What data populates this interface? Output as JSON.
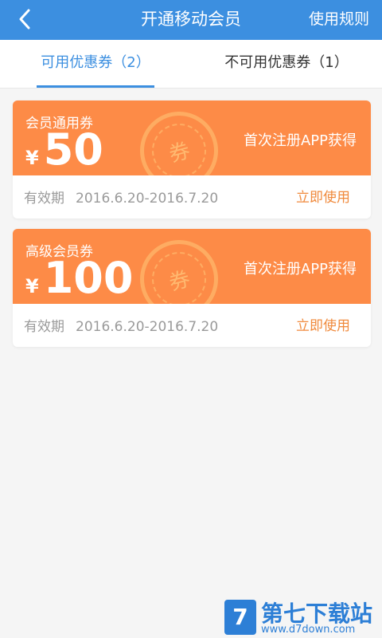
{
  "header": {
    "title": "开通移动会员",
    "rules_label": "使用规则",
    "back_icon": "chevron-left-icon"
  },
  "tabs": [
    {
      "label": "可用优惠券（2）",
      "active": true
    },
    {
      "label": "不可用优惠券（1）",
      "active": false
    }
  ],
  "coupons": [
    {
      "name": "会员通用券",
      "currency": "¥",
      "amount": "50",
      "source": "首次注册APP获得",
      "validity_label": "有效期",
      "validity_range": "2016.6.20-2016.7.20",
      "use_label": "立即使用",
      "stamp_char": "券"
    },
    {
      "name": "高级会员券",
      "currency": "¥",
      "amount": "100",
      "source": "首次注册APP获得",
      "validity_label": "有效期",
      "validity_range": "2016.6.20-2016.7.20",
      "use_label": "立即使用",
      "stamp_char": "券"
    }
  ],
  "watermark": {
    "logo_char": "7",
    "brand": "第七下载站",
    "url": "www.d7down.com"
  },
  "colors": {
    "primary": "#3c8fe0",
    "coupon": "#fd8b47",
    "use_text": "#f08a3c",
    "background": "#f5f5f5"
  }
}
